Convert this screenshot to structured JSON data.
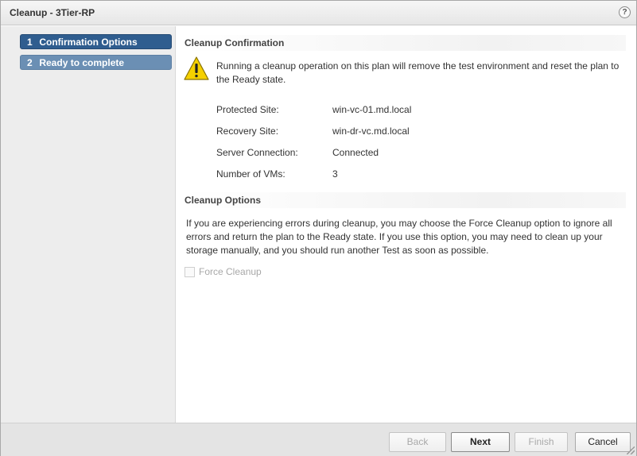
{
  "dialog": {
    "title": "Cleanup - 3Tier-RP",
    "help_glyph": "?"
  },
  "nav": {
    "steps": [
      {
        "num": "1",
        "label": "Confirmation Options",
        "state": "active"
      },
      {
        "num": "2",
        "label": "Ready to complete",
        "state": "inactive"
      }
    ]
  },
  "confirmation": {
    "header": "Cleanup Confirmation",
    "warning_text": "Running a cleanup operation on this plan will remove the test environment and reset the plan to the Ready state.",
    "details": [
      {
        "label": "Protected Site:",
        "value": "win-vc-01.md.local"
      },
      {
        "label": "Recovery Site:",
        "value": "win-dr-vc.md.local"
      },
      {
        "label": "Server Connection:",
        "value": "Connected"
      },
      {
        "label": "Number of VMs:",
        "value": "3"
      }
    ]
  },
  "options": {
    "header": "Cleanup Options",
    "description": "If you are experiencing errors during cleanup, you may choose the Force Cleanup option to ignore all errors and return the plan to the Ready state. If you use this option, you may need to clean up your storage manually, and you should run another Test as soon as possible.",
    "force_cleanup_label": "Force Cleanup",
    "force_cleanup_checked": false,
    "force_cleanup_enabled": false
  },
  "footer": {
    "back_label": "Back",
    "next_label": "Next",
    "finish_label": "Finish",
    "cancel_label": "Cancel"
  },
  "colors": {
    "active_step": "#2f5d8f",
    "inactive_step": "#6b8fb4",
    "warning_yellow": "#f5d000"
  },
  "icons": {
    "warning": "warning-triangle-icon",
    "help": "help-icon"
  }
}
